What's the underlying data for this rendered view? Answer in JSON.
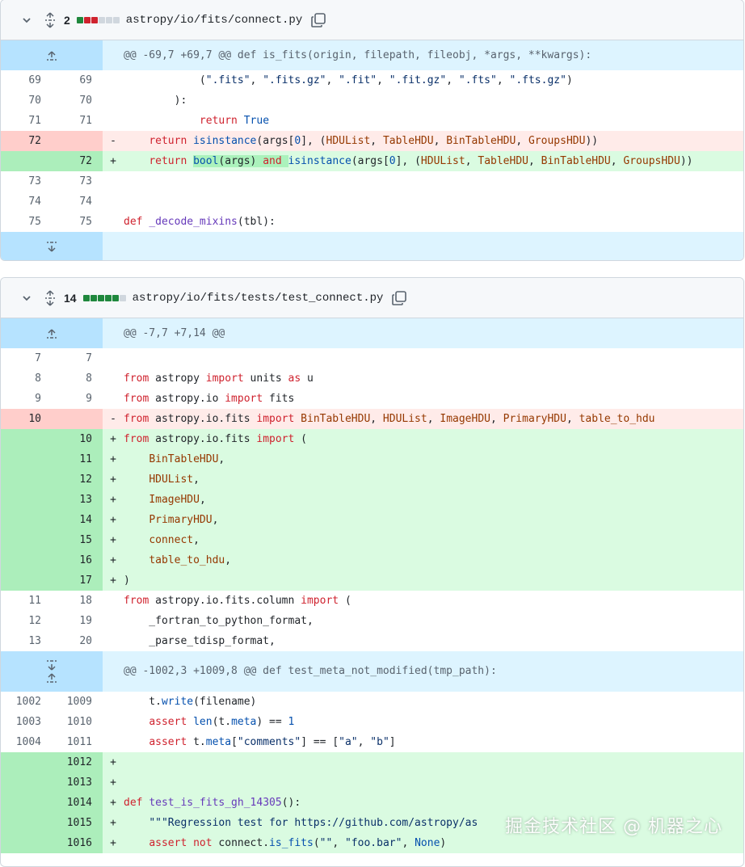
{
  "file1": {
    "change_count": "2",
    "filename": "astropy/io/fits/connect.py",
    "hunk_header": "@@ -69,7 +69,7 @@ def is_fits(origin, filepath, fileobj, *args, **kwargs):",
    "lines": [
      {
        "type": "ctx",
        "left": "69",
        "right": "69",
        "mark": " ",
        "code": "            (\".fits\", \".fits.gz\", \".fit\", \".fit.gz\", \".fts\", \".fts.gz\")"
      },
      {
        "type": "ctx",
        "left": "70",
        "right": "70",
        "mark": " ",
        "code": "        ):"
      },
      {
        "type": "ctx",
        "left": "71",
        "right": "71",
        "mark": " ",
        "code": "            return True"
      },
      {
        "type": "del",
        "left": "72",
        "right": "",
        "mark": "-",
        "code": "    return isinstance(args[0], (HDUList, TableHDU, BinTableHDU, GroupsHDU))"
      },
      {
        "type": "add",
        "left": "",
        "right": "72",
        "mark": "+",
        "code": "    return bool(args) and isinstance(args[0], (HDUList, TableHDU, BinTableHDU, GroupsHDU))"
      },
      {
        "type": "ctx",
        "left": "73",
        "right": "73",
        "mark": " ",
        "code": ""
      },
      {
        "type": "ctx",
        "left": "74",
        "right": "74",
        "mark": " ",
        "code": ""
      },
      {
        "type": "ctx",
        "left": "75",
        "right": "75",
        "mark": " ",
        "code": "def _decode_mixins(tbl):"
      }
    ]
  },
  "file2": {
    "change_count": "14",
    "filename": "astropy/io/fits/tests/test_connect.py",
    "hunk_header_1": "@@ -7,7 +7,14 @@",
    "hunk_header_2": "@@ -1002,3 +1009,8 @@ def test_meta_not_modified(tmp_path):",
    "lines_1": [
      {
        "type": "ctx",
        "left": "7",
        "right": "7",
        "mark": " ",
        "code": ""
      },
      {
        "type": "ctx",
        "left": "8",
        "right": "8",
        "mark": " ",
        "code": "from astropy import units as u"
      },
      {
        "type": "ctx",
        "left": "9",
        "right": "9",
        "mark": " ",
        "code": "from astropy.io import fits"
      },
      {
        "type": "del",
        "left": "10",
        "right": "",
        "mark": "-",
        "code": "from astropy.io.fits import BinTableHDU, HDUList, ImageHDU, PrimaryHDU, table_to_hdu"
      },
      {
        "type": "add",
        "left": "",
        "right": "10",
        "mark": "+",
        "code": "from astropy.io.fits import ("
      },
      {
        "type": "add",
        "left": "",
        "right": "11",
        "mark": "+",
        "code": "    BinTableHDU,"
      },
      {
        "type": "add",
        "left": "",
        "right": "12",
        "mark": "+",
        "code": "    HDUList,"
      },
      {
        "type": "add",
        "left": "",
        "right": "13",
        "mark": "+",
        "code": "    ImageHDU,"
      },
      {
        "type": "add",
        "left": "",
        "right": "14",
        "mark": "+",
        "code": "    PrimaryHDU,"
      },
      {
        "type": "add",
        "left": "",
        "right": "15",
        "mark": "+",
        "code": "    connect,"
      },
      {
        "type": "add",
        "left": "",
        "right": "16",
        "mark": "+",
        "code": "    table_to_hdu,"
      },
      {
        "type": "add",
        "left": "",
        "right": "17",
        "mark": "+",
        "code": ")"
      },
      {
        "type": "ctx",
        "left": "11",
        "right": "18",
        "mark": " ",
        "code": "from astropy.io.fits.column import ("
      },
      {
        "type": "ctx",
        "left": "12",
        "right": "19",
        "mark": " ",
        "code": "    _fortran_to_python_format,"
      },
      {
        "type": "ctx",
        "left": "13",
        "right": "20",
        "mark": " ",
        "code": "    _parse_tdisp_format,"
      }
    ],
    "lines_2": [
      {
        "type": "ctx",
        "left": "1002",
        "right": "1009",
        "mark": " ",
        "code": "    t.write(filename)"
      },
      {
        "type": "ctx",
        "left": "1003",
        "right": "1010",
        "mark": " ",
        "code": "    assert len(t.meta) == 1"
      },
      {
        "type": "ctx",
        "left": "1004",
        "right": "1011",
        "mark": " ",
        "code": "    assert t.meta[\"comments\"] == [\"a\", \"b\"]"
      },
      {
        "type": "add",
        "left": "",
        "right": "1012",
        "mark": "+",
        "code": ""
      },
      {
        "type": "add",
        "left": "",
        "right": "1013",
        "mark": "+",
        "code": ""
      },
      {
        "type": "add",
        "left": "",
        "right": "1014",
        "mark": "+",
        "code": "def test_is_fits_gh_14305():"
      },
      {
        "type": "add",
        "left": "",
        "right": "1015",
        "mark": "+",
        "code": "    \"\"\"Regression test for https://github.com/astropy/as"
      },
      {
        "type": "add",
        "left": "",
        "right": "1016",
        "mark": "+",
        "code": "    assert not connect.is_fits(\"\", \"foo.bar\", None)"
      }
    ]
  },
  "watermark": "掘金技术社区 @ 机器之心"
}
